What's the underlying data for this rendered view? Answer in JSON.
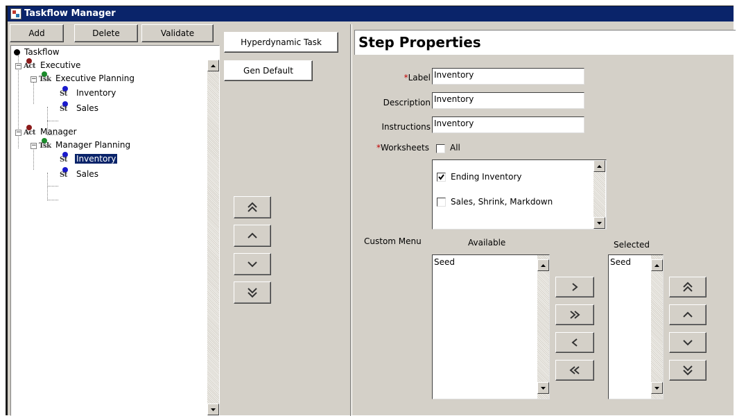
{
  "window": {
    "title": "Taskflow Manager"
  },
  "toolbar": {
    "add_label": "Add",
    "delete_label": "Delete",
    "validate_label": "Validate",
    "hyperdynamic_label": "Hyperdynamic Task",
    "gen_default_label": "Gen Default"
  },
  "tree": {
    "root": "Taskflow",
    "actor1": {
      "label": "Executive",
      "icon": "Act"
    },
    "task1": {
      "label": "Executive Planning",
      "icon": "Tsk"
    },
    "step1a": {
      "label": "Inventory",
      "icon": "St"
    },
    "step1b": {
      "label": "Sales",
      "icon": "St"
    },
    "actor2": {
      "label": "Manager",
      "icon": "Act"
    },
    "task2": {
      "label": "Manager Planning",
      "icon": "Tsk"
    },
    "step2a": {
      "label": "Inventory",
      "icon": "St",
      "selected": true
    },
    "step2b": {
      "label": "Sales",
      "icon": "St"
    }
  },
  "properties": {
    "heading": "Step Properties",
    "required_mark": "*",
    "label_label": "Label",
    "label_value": "Inventory",
    "description_label": "Description",
    "description_value": "Inventory",
    "instructions_label": "Instructions",
    "instructions_value": "Inventory",
    "worksheets_label": "Worksheets",
    "all_label": "All",
    "all_checked": false,
    "worksheets": [
      {
        "label": "Ending Inventory",
        "checked": true
      },
      {
        "label": "Sales, Shrink, Markdown",
        "checked": false
      }
    ],
    "custom_menu_label": "Custom Menu",
    "available_label": "Available",
    "selected_label": "Selected",
    "available_items": [
      "Seed"
    ],
    "selected_items": [
      "Seed"
    ]
  },
  "icons": {
    "move_top": "double-chevron-up-icon",
    "move_up": "chevron-up-icon",
    "move_down": "chevron-down-icon",
    "move_bottom": "double-chevron-down-icon",
    "add_one": "chevron-right-icon",
    "add_all": "double-chevron-right-icon",
    "remove_one": "chevron-left-icon",
    "remove_all": "double-chevron-left-icon"
  },
  "colors": {
    "titlebar": "#0a246a",
    "selection": "#0a246a",
    "actor_dot": "#8b1a1a",
    "task_dot": "#1a8b2a",
    "step_dot": "#1a1acc",
    "required": "#c00000"
  }
}
